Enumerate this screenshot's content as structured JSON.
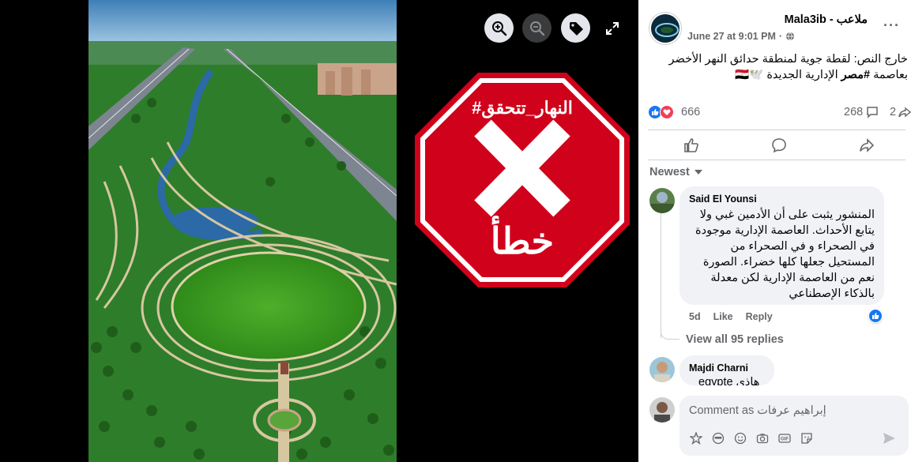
{
  "viewer": {
    "stamp_hashtag": "#النهار_تتحقق",
    "stamp_verdict": "خطأ",
    "stamp_color": "#d0021b"
  },
  "post": {
    "page_name": "ملاعب - Mala3ib",
    "date": "June 27 at 9:01 PM",
    "privacy": "·",
    "text_line1": "خارج النص: لقطة جوية لمنطقة حدائق النهر الأخضر",
    "text_line2_prefix": "بعاصمة ",
    "text_hashtag": "#مصر",
    "text_line2_suffix": " الإدارية الجديدة 🕊️🇪🇬",
    "reaction_count": "666",
    "comment_count": "268",
    "share_count": "2"
  },
  "comments": {
    "sort_label": "Newest",
    "items": [
      {
        "author": "Said El Younsi",
        "text": "المنشور يثبت على أن الأدمين غبي ولا يتابع الأحداث. العاصمة الإدارية موجودة في الصحراء و في الصحراء من المستحيل جعلها كلها خضراء. الصورة نعم من العاصمة الإدارية لكن معدلة بالذكاء الإصطناعي",
        "age": "5d",
        "like_label": "Like",
        "reply_label": "Reply"
      },
      {
        "author": "Majdi Charni",
        "text": "egypte هاذي"
      }
    ],
    "view_replies": "View all 95 replies"
  },
  "composer": {
    "placeholder": "Comment as إبراهيم عرفات"
  },
  "colors": {
    "facebook_blue": "#1877f2",
    "love_red": "#f33e58",
    "secondary_text": "#65676b"
  }
}
